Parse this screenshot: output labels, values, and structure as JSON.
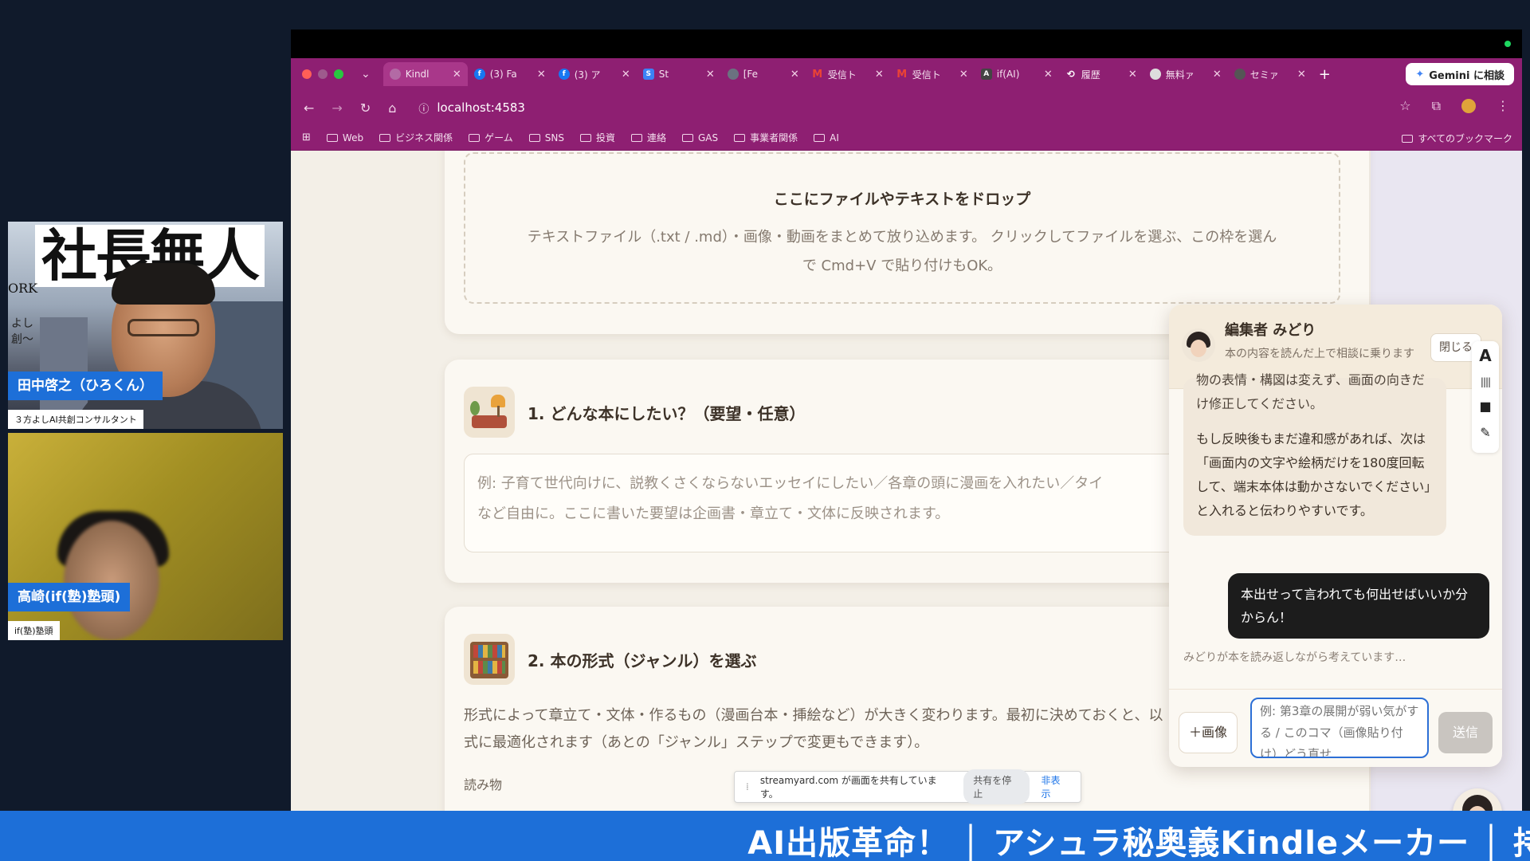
{
  "participants": [
    {
      "name": "田中啓之（ひろくん）",
      "title": "３方よしAI共創コンサルタント",
      "background_text": "社長無人",
      "side_text": "ORK",
      "sub_text": "よし\n創〜"
    },
    {
      "name": "高崎(if(塾)塾頭)",
      "title": "if(塾)塾頭"
    }
  ],
  "browser": {
    "tabs": [
      {
        "label": "Kindl",
        "icon": "kindle-icon",
        "color": "#b36aa5"
      },
      {
        "label": "(3) Fa",
        "icon": "facebook-icon",
        "color": "#1877f2"
      },
      {
        "label": "(3) ア",
        "icon": "facebook-icon",
        "color": "#1877f2"
      },
      {
        "label": "St",
        "icon": "s-icon",
        "color": "#3b82f6"
      },
      {
        "label": "[Fe",
        "icon": "globe-icon",
        "color": "#6b7280"
      },
      {
        "label": "受信ト",
        "icon": "gmail-icon",
        "color": "#ea4335"
      },
      {
        "label": "受信ト",
        "icon": "gmail-icon",
        "color": "#ea4335"
      },
      {
        "label": "if(AI)",
        "icon": "ai-icon",
        "color": "#444444"
      },
      {
        "label": "履歴",
        "icon": "history-icon",
        "color": "#666666"
      },
      {
        "label": "無料ァ",
        "icon": "circle-icon",
        "color": "#555555"
      },
      {
        "label": "セミァ",
        "icon": "seminar-icon",
        "color": "#555555"
      }
    ],
    "new_tab": "+",
    "gemini_label": "Gemini に相談",
    "url": "localhost:4583",
    "bookmarks": [
      "Web",
      "ビジネス関係",
      "ゲーム",
      "SNS",
      "投資",
      "連絡",
      "GAS",
      "事業者関係",
      "AI"
    ],
    "all_bookmarks": "すべてのブックマーク"
  },
  "page": {
    "dropzone": {
      "title": "ここにファイルやテキストをドロップ",
      "desc_line1": "テキストファイル（.txt / .md）・画像・動画をまとめて放り込めます。 クリックしてファイルを選ぶ、この枠を選ん",
      "desc_line2": "で Cmd+V で貼り付けもOK。"
    },
    "section1": {
      "title": "1. どんな本にしたい？（要望・任意）",
      "placeholder_line1": "例: 子育て世代向けに、説教くさくならないエッセイにしたい／各章の頭に漫画を入れたい／タイ",
      "placeholder_line2": "など自由に。ここに書いた要望は企画書・章立て・文体に反映されます。"
    },
    "section2": {
      "title": "2. 本の形式（ジャンル）を選ぶ",
      "desc_line1": "形式によって章立て・文体・作るもの（漫画台本・挿絵など）が大きく変わります。最初に決めておくと、以",
      "desc_line2": "式に最適化されます（あとの「ジャンル」ステップで変更もできます）。",
      "genre_label": "読み物"
    },
    "share_bar": {
      "text": "streamyard.com が画面を共有しています。",
      "stop": "共有を停止",
      "hide": "非表示"
    }
  },
  "chat": {
    "name": "編集者 みどり",
    "subtitle": "本の内容を読んだ上で相談に乗ります",
    "close": "閉じる",
    "assistant_partial": "物の表情・構図は変えず、画面の向きだけ修正してください。",
    "assistant_message": "もし反映後もまだ違和感があれば、次は「画面内の文字や絵柄だけを180度回転して、端末本体は動かさないでください」と入れると伝わりやすいです。",
    "user_message": "本出せって言われても何出せばいいか分からん！",
    "thinking": "みどりが本を読み返しながら考えています…",
    "image_button": "＋画像",
    "input_placeholder": "例: 第3章の展開が弱い気がする / このコマ（画像貼り付け）どう直せ",
    "send": "送信"
  },
  "ticker": "AI出版革命！ │ アシュラ秘奥義Kindleメーカー │ 持"
}
